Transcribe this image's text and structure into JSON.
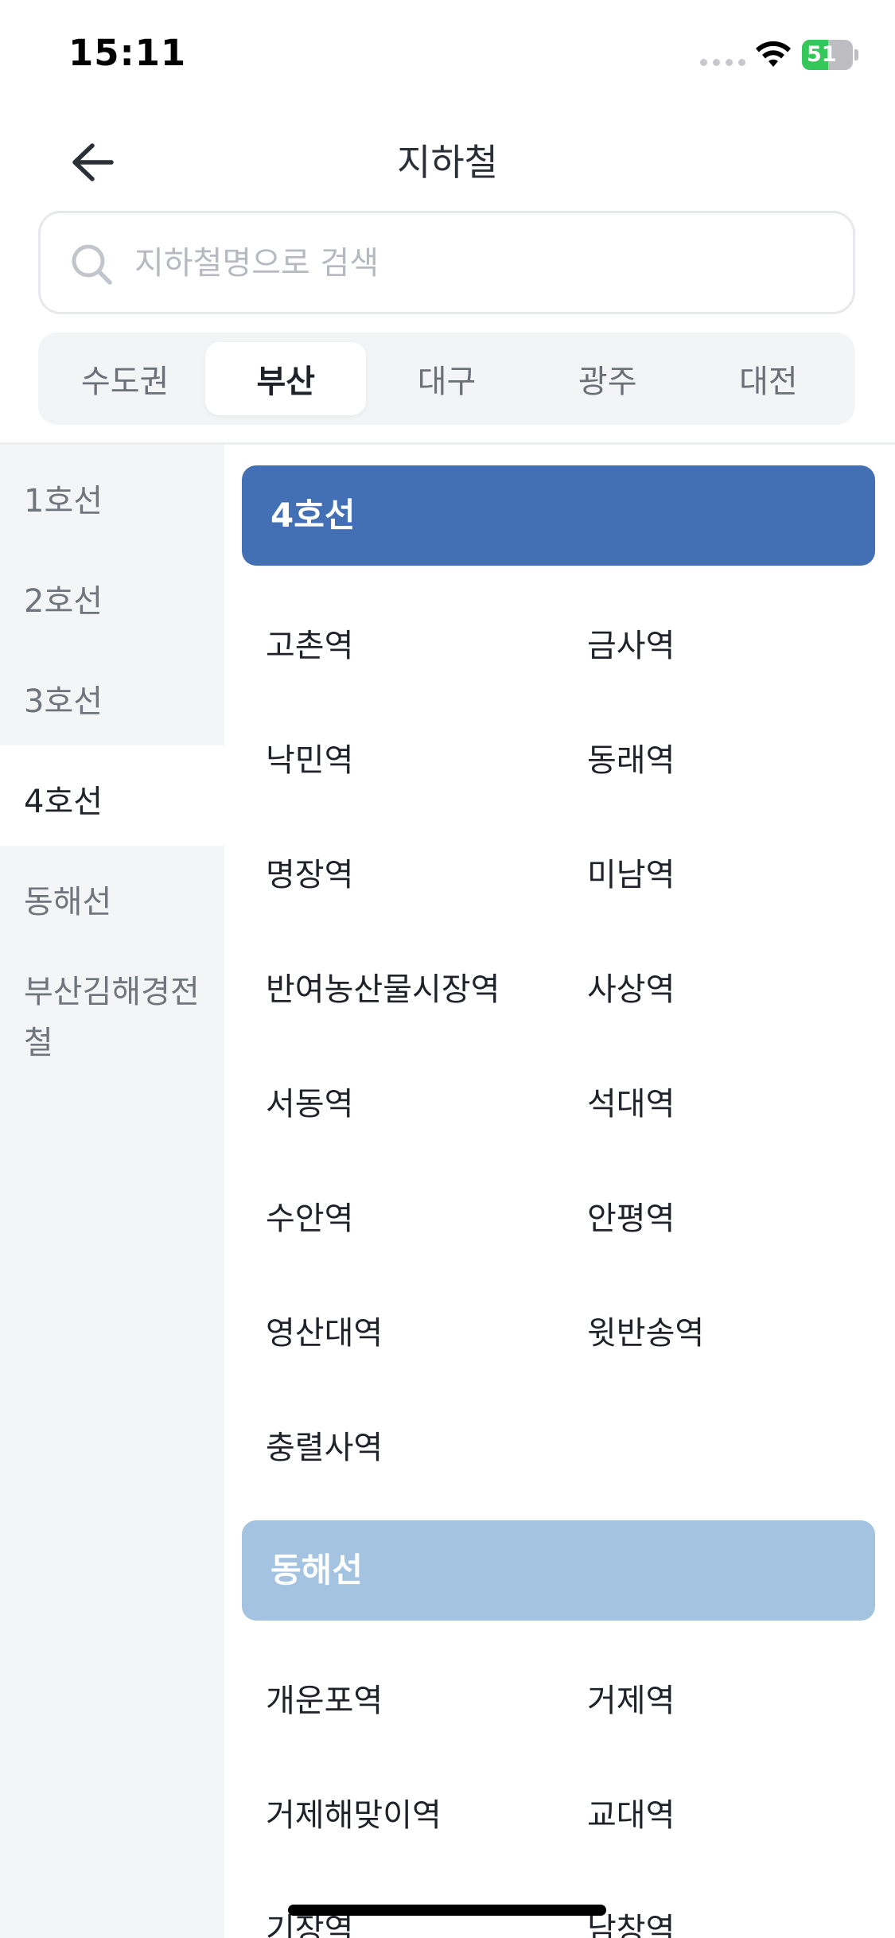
{
  "status_bar": {
    "time": "15:11",
    "battery_level": "51",
    "battery_percent": 51,
    "battery_color": "#34c759",
    "icons": [
      "cellular-signal-icon",
      "wifi-icon",
      "battery-charging-icon"
    ]
  },
  "header": {
    "title": "지하철",
    "back_icon": "arrow-left-icon"
  },
  "search": {
    "placeholder": "지하철명으로 검색",
    "value": "",
    "icon": "search-icon"
  },
  "region_tabs": [
    {
      "label": "수도권",
      "active": false
    },
    {
      "label": "부산",
      "active": true
    },
    {
      "label": "대구",
      "active": false
    },
    {
      "label": "광주",
      "active": false
    },
    {
      "label": "대전",
      "active": false
    }
  ],
  "lines": [
    {
      "label": "1호선",
      "active": false
    },
    {
      "label": "2호선",
      "active": false
    },
    {
      "label": "3호선",
      "active": false
    },
    {
      "label": "4호선",
      "active": true
    },
    {
      "label": "동해선",
      "active": false
    },
    {
      "label": "부산김해경전철",
      "active": false
    }
  ],
  "sections": [
    {
      "title": "4호선",
      "color": "#436fb5",
      "stations": [
        "고촌역",
        "금사역",
        "낙민역",
        "동래역",
        "명장역",
        "미남역",
        "반여농산물시장역",
        "사상역",
        "서동역",
        "석대역",
        "수안역",
        "안평역",
        "영산대역",
        "윗반송역",
        "충렬사역"
      ]
    },
    {
      "title": "동해선",
      "color": "#a4c3e1",
      "stations": [
        "개운포역",
        "거제역",
        "거제해맞이역",
        "교대역",
        "기장역",
        "남창역"
      ]
    }
  ],
  "colors": {
    "accent": "#436fb5",
    "accent_light": "#a4c3e1",
    "sidebar_bg": "#f4f5f7"
  }
}
